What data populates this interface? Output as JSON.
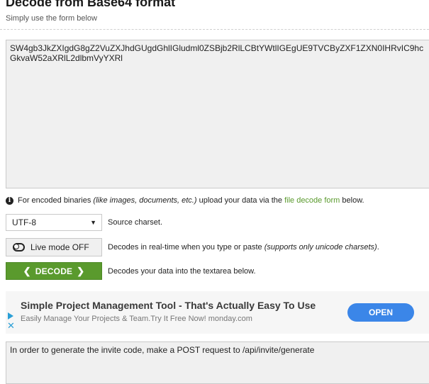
{
  "header": {
    "title": "Decode from Base64 format",
    "subtitle": "Simply use the form below"
  },
  "input": {
    "value": "SW4gb3JkZXIgdG8gZ2VuZXJhdGUgdGhlIGludml0ZSBjb2RlLCBtYWtlIGEgUE9TVCByZXF1ZXN0IHRvIC9hcGkvaW52aXRlL2dlbmVyYXRl"
  },
  "info": {
    "prefix": "For encoded binaries",
    "italic": "(like images, documents, etc.)",
    "middle": "upload your data via the",
    "link": "file decode form",
    "suffix": "below."
  },
  "charset": {
    "selected": "UTF-8",
    "label": "Source charset."
  },
  "live_mode": {
    "button_label": "Live mode OFF",
    "description": "Decodes in real-time when you type or paste",
    "note": "(supports only unicode charsets)",
    "note_end": "."
  },
  "decode": {
    "button_label": "DECODE",
    "description": "Decodes your data into the textarea below."
  },
  "ad": {
    "title": "Simple Project Management Tool - That's Actually Easy To Use",
    "description": "Easily Manage Your Projects & Team.Try It Free Now! monday.com",
    "cta": "OPEN"
  },
  "output": {
    "value": "In order to generate the invite code, make a POST request to /api/invite/generate"
  },
  "colors": {
    "accent": "#5a9a2d",
    "ad_button": "#3b86e8",
    "ad_icon": "#2a9fd6"
  }
}
